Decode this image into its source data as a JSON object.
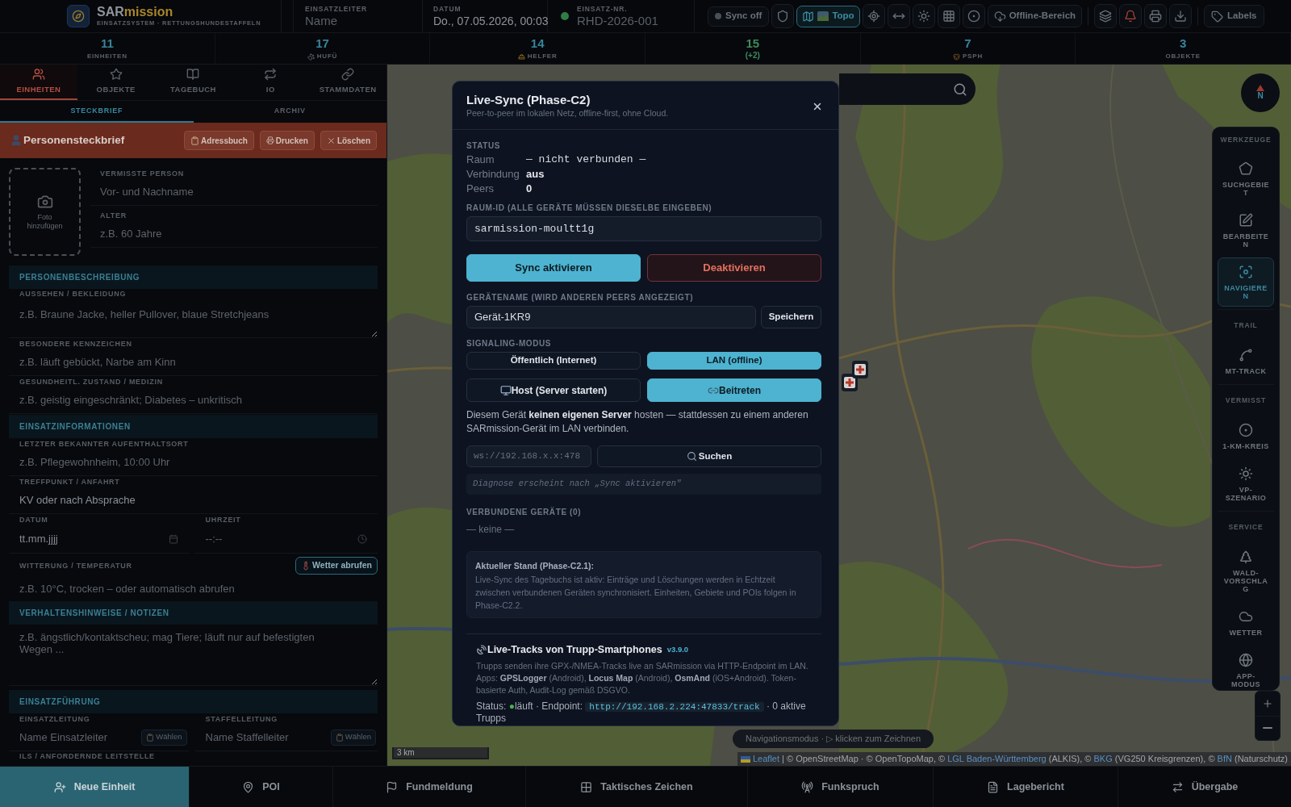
{
  "header": {
    "title": [
      {
        "text": "SAR",
        "kind": "plain"
      },
      {
        "text": "mission",
        "kind": "accent"
      }
    ],
    "subtitle": "EINSATZSYSTEM · RETTUNGSHUNDESTAFFELN",
    "fields": [
      {
        "kind": "input",
        "label": "EINSATZLEITER",
        "placeholder": "Name"
      },
      {
        "kind": "display",
        "label": "DATUM",
        "value": "Do., 07.05.2026, 00:03"
      },
      {
        "kind": "status",
        "label": "EINSATZ-NR.",
        "placeholder": "RHD-2026-001"
      }
    ],
    "toolbar": {
      "sync": "Sync off",
      "map_style": {
        "label": "Topo",
        "selected": true
      },
      "offline": "Offline-Bereich",
      "labels": "Labels"
    }
  },
  "stats": [
    {
      "value": "11",
      "label": "EINHEITEN",
      "color": "#35859b"
    },
    {
      "value": "17",
      "label": "HUFÜ",
      "color": "#35859b"
    },
    {
      "value": "14",
      "label": "HELFER",
      "color": "#35859b"
    },
    {
      "value": "15",
      "delta": "(+2)",
      "color": "#3d8b5c"
    },
    {
      "value": "7",
      "label": "PSPH",
      "color": "#35859b"
    },
    {
      "value": "3",
      "label": "OBJEKTE",
      "color": "#35859b"
    }
  ],
  "sidebar": {
    "tabs": [
      {
        "label": "EINHEITEN",
        "selected": true
      },
      {
        "label": "OBJEKTE",
        "selected": false
      },
      {
        "label": "TAGEBUCH",
        "selected": false
      },
      {
        "label": "IO",
        "selected": false
      },
      {
        "label": "STAMMDATEN",
        "selected": false
      }
    ],
    "subtabs": [
      {
        "label": "STECKBRIEF",
        "selected": true
      },
      {
        "label": "ARCHIV",
        "selected": false
      }
    ],
    "profile": {
      "title": "Personensteckbrief",
      "buttons": [
        "Adressbuch",
        "Drucken",
        "Löschen"
      ]
    },
    "photo": "Foto hinzufügen",
    "person": [
      {
        "label": "VERMISSTE PERSON",
        "placeholder": "Vor- und Nachname"
      },
      {
        "label": "ALTER",
        "placeholder": "z.B. 60 Jahre"
      }
    ],
    "form": [
      {
        "kind": "section",
        "title": "PERSONENBESCHREIBUNG"
      },
      {
        "kind": "textarea",
        "label": "AUSSEHEN / BEKLEIDUNG",
        "placeholder": "z.B. Braune Jacke, heller Pullover, blaue Stretchjeans"
      },
      {
        "kind": "input",
        "label": "BESONDERE KENNZEICHEN",
        "placeholder": "z.B. läuft gebückt, Narbe am Kinn"
      },
      {
        "kind": "input",
        "label": "GESUNDHEITL. ZUSTAND / MEDIZIN",
        "placeholder": "z.B. geistig eingeschränkt; Diabetes – unkritisch"
      },
      {
        "kind": "section",
        "title": "EINSATZINFORMATIONEN"
      },
      {
        "kind": "input",
        "label": "LETZTER BEKANNTER AUFENTHALTSORT",
        "placeholder": "z.B. Pflegewohnheim, 10:00 Uhr"
      },
      {
        "kind": "input",
        "label": "TREFFPUNKT / ANFAHRT",
        "value": "KV oder nach Absprache"
      },
      {
        "kind": "pair",
        "fields": [
          {
            "kind": "date",
            "label": "DATUM",
            "value": "tt.mm.jjjj"
          },
          {
            "kind": "time",
            "label": "UHRZEIT",
            "placeholder": "--:--"
          }
        ]
      },
      {
        "kind": "action_input",
        "label": "WITTERUNG / TEMPERATUR",
        "action": "Wetter abrufen",
        "placeholder": "z.B. 10°C, trocken – oder automatisch abrufen"
      },
      {
        "kind": "section",
        "title": "VERHALTENSHINWEISE / NOTIZEN"
      },
      {
        "kind": "notes",
        "placeholder": "z.B. ängstlich/kontaktscheu; mag Tiere; läuft nur auf befestigten Wegen ..."
      },
      {
        "kind": "section",
        "title": "EINSATZFÜHRUNG"
      },
      {
        "kind": "pair",
        "fields": [
          {
            "kind": "picker",
            "label": "EINSATZLEITUNG",
            "placeholder": "Name Einsatzleiter",
            "action": "Wählen"
          },
          {
            "kind": "picker",
            "label": "STAFFELLEITUNG",
            "placeholder": "Name Staffelleiter",
            "action": "Wählen"
          }
        ]
      },
      {
        "kind": "label",
        "label": "ILS / ANFORDERNDE LEITSTELLE"
      }
    ]
  },
  "map": {
    "compass": "N",
    "tools": [
      {
        "title": "WERKZEUGE",
        "items": [
          {
            "label": "SUCHGEBIET",
            "selected": false
          },
          {
            "label": "BEARBEITEN",
            "selected": false
          },
          {
            "label": "NAVIGIEREN",
            "selected": true
          }
        ]
      },
      {
        "title": "TRAIL",
        "items": [
          {
            "label": "MT-TRACK",
            "selected": false
          }
        ]
      },
      {
        "title": "VERMISST",
        "items": [
          {
            "label": "1-KM-KREIS",
            "selected": false
          },
          {
            "label": "VP-SZENARIO",
            "selected": false
          }
        ]
      },
      {
        "title": "SERVICE",
        "items": [
          {
            "label": "WALD-VORSCHLAG",
            "selected": false
          },
          {
            "label": "WETTER",
            "selected": false
          },
          {
            "label": "APP-MODUS",
            "selected": false
          }
        ]
      }
    ],
    "scale": "3 km",
    "hint": "Navigationsmodus · ▷ klicken zum Zeichnen",
    "attribution": [
      {
        "text": "Leaflet",
        "kind": "link"
      },
      {
        "text": "| © OpenStreetMap · © OpenTopoMap, ©",
        "kind": "text"
      },
      {
        "text": "LGL Baden-Württemberg",
        "kind": "link"
      },
      {
        "text": "(ALKIS), ©",
        "kind": "text"
      },
      {
        "text": "BKG",
        "kind": "link"
      },
      {
        "text": "(VG250 Kreisgrenzen), ©",
        "kind": "text"
      },
      {
        "text": "BfN",
        "kind": "link"
      },
      {
        "text": "(Naturschutz)",
        "kind": "text"
      }
    ]
  },
  "actions": [
    {
      "label": "Neue Einheit",
      "selected": true
    },
    {
      "label": "POI",
      "selected": false
    },
    {
      "label": "Fundmeldung",
      "selected": false
    },
    {
      "label": "Taktisches Zeichen",
      "selected": false
    },
    {
      "label": "Funkspruch",
      "selected": false
    },
    {
      "label": "Lagebericht",
      "selected": false
    },
    {
      "label": "Übergabe",
      "selected": false
    }
  ],
  "dialog": {
    "title": "Live-Sync (Phase-C2)",
    "subtitle": "Peer-to-peer im lokalen Netz, offline-first, ohne Cloud.",
    "status": {
      "heading": "STATUS",
      "rows": [
        {
          "key": "Raum",
          "value": "— nicht verbunden —",
          "kind": "mono"
        },
        {
          "key": "Verbindung",
          "value": "aus",
          "kind": "bold"
        },
        {
          "key": "Peers",
          "value": "0",
          "kind": "bold"
        }
      ]
    },
    "room": {
      "label": "RAUM-ID (ALLE GERÄTE MÜSSEN DIESELBE EINGEBEN)",
      "value": "sarmission-moultt1g"
    },
    "actions": [
      {
        "label": "Sync aktivieren",
        "kind": "primary"
      },
      {
        "label": "Deaktivieren",
        "kind": "danger"
      }
    ],
    "device": {
      "label": "GERÄTENAME (WIRD ANDEREN PEERS ANGEZEIGT)",
      "value": "Gerät-1KR9",
      "button": "Speichern"
    },
    "signaling": {
      "label": "SIGNALING-MODUS",
      "modes": [
        {
          "label": "Öffentlich (Internet)",
          "selected": false
        },
        {
          "label": "LAN (offline)",
          "selected": true
        }
      ],
      "roles": [
        {
          "label": "Host (Server starten)",
          "selected": false
        },
        {
          "label": "Beitreten",
          "selected": true
        }
      ],
      "hint": "Diesem Gerät **keinen eigenen Server** hosten — stattdessen zu einem anderen SARmission-Gerät im LAN verbinden."
    },
    "server": {
      "placeholder": "ws://192.168.x.x:478",
      "button": "Suchen"
    },
    "diagnose": "Diagnose erscheint nach „Sync aktivieren\"",
    "peers": {
      "heading": "VERBUNDENE GERÄTE (0)",
      "empty": "— keine —"
    },
    "info": {
      "title": "Aktueller Stand (Phase-C2.1):",
      "text": "Live-Sync des Tagebuchs ist aktiv: Einträge und Löschungen werden in Echtzeit zwischen verbundenen Geräten synchronisiert. Einheiten, Gebiete und POIs folgen in Phase-C2.2."
    },
    "live_tracks": {
      "title": "Live-Tracks von Trupp-Smartphones",
      "version": "v3.9.0",
      "text": "Trupps senden ihre GPX-/NMEA-Tracks live an SARmission via HTTP-Endpoint im LAN. Apps: **GPSLogger** (Android), **Locus Map** (Android), **OsmAnd** (iOS+Android). Token-basierte Auth, Audit-Log gemäß DSGVO.",
      "status_label": "Status:",
      "status_symbol": "●",
      "status": "läuft · Endpoint:",
      "endpoint": "http://192.168.2.224:47833/track",
      "tail": "· 0 aktive Trupps"
    }
  }
}
